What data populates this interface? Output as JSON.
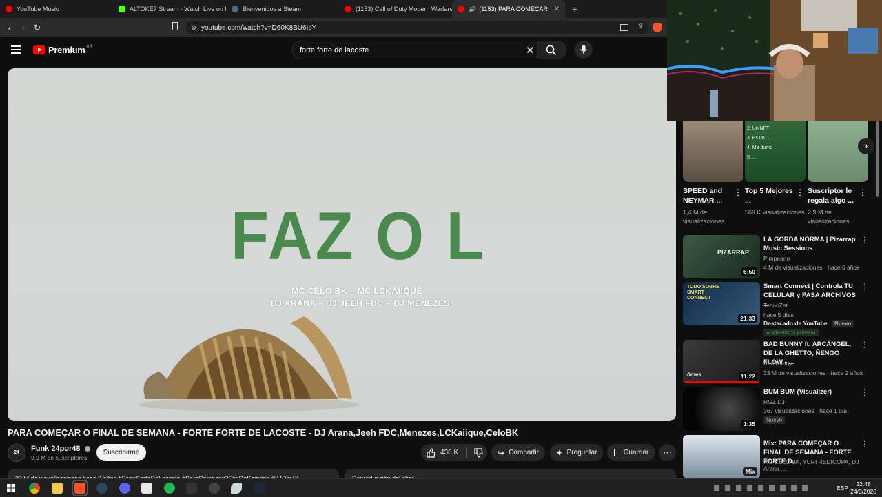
{
  "browser": {
    "tabs": [
      {
        "label": "YouTube Music",
        "color": "#ff0000"
      },
      {
        "label": "ALTOKE7 Stream - Watch Live on Kick",
        "color": "#53fc18"
      },
      {
        "label": "Bienvenidos a Steam",
        "color": "#1b2838"
      },
      {
        "label": "(1153) Call of Duty Modern Warfare",
        "color": "#ff0000"
      },
      {
        "label": "(1153) PARA COMEÇAR O FIN",
        "color": "#ff0000"
      }
    ],
    "new_tab": "+",
    "url": "youtube.com/watch?v=D60K8BU6IsY"
  },
  "masthead": {
    "logo_text": "Premium",
    "country": "AR",
    "search_value": "forte forte de lacoste"
  },
  "video": {
    "overlay_title": "FAZ O L",
    "credit_line1": "MC CELO BK – MC LCKAIIQUE",
    "credit_line2": "DJ ARANA – DJ JEEH FDC – DJ MENEZES",
    "title": "PARA COMEÇAR O FINAL DE SEMANA - FORTE FORTE DE LACOSTE - DJ Arana,Jeeh FDC,Menezes,LCKaiique,CeloBK",
    "channel": "Funk 24por48",
    "avatar": "24",
    "subscribers": "9,9 M de suscriptores",
    "subscribe": "Suscribirme",
    "likes": "438 K",
    "share": "Compartir",
    "ask": "Preguntar",
    "save": "Guardar",
    "description": "33 M de visualizaciones hace 2 años #ForteForteDeLacoste #ParaComeçarOFimDeSemana #24Por48",
    "chat": "Reproducción del chat"
  },
  "shorts": [
    {
      "title": "SPEED and NEYMAR ...",
      "views": "1,4 M de visualizaciones",
      "c1": "#7a6a5a",
      "c2": "#c9b9a4"
    },
    {
      "title": "Top 5 Mejores ...",
      "views": "569 K visualizaciones",
      "c1": "#2f6a3a",
      "c2": "#d8e0d2",
      "list": [
        "2. Un NFT",
        "3. Es un ...",
        "4. Me dumo",
        "5. ..."
      ]
    },
    {
      "title": "Suscriptor le regala algo ...",
      "views": "2,9 M de visualizaciones",
      "c1": "#6b8a6e",
      "c2": "#e6d2c5"
    }
  ],
  "recommended": [
    {
      "title": "LA GORDA NORMA | Pizarrap Music Sessions",
      "channel": "Pimpeano",
      "meta": "4 M de visualizaciones · hace 6 años",
      "duration": "6:50",
      "thumb_text": "PIZARRAP",
      "c1": "#1f3a2a",
      "c2": "#c7c7c7"
    },
    {
      "title": "Smart Connect | Controla TU CELULAR y PASA ARCHIVOS ...",
      "channel": "TecnoZet",
      "meta": "hace 5 días",
      "duration": "21:33",
      "thumb_text": "TODO SOBRE SMART CONNECT",
      "badge1": "Destacado de YouTube",
      "badge2": "Nuevo",
      "members": "Miembros primero",
      "c1": "#0d2a4a",
      "c2": "#e2c19c"
    },
    {
      "title": "BAD BUNNY ft. ARCÁNGEL, DE LA GHETTO, ÑENGO FLOW - ...",
      "channel": "Bad Bunny",
      "meta": "33 M de visualizaciones · hace 2 años",
      "duration": "11:22",
      "thumb_text": "ómes",
      "c1": "#2a2a2a",
      "c2": "#8b7a62"
    },
    {
      "title": "BUM BUM (Visualizer)",
      "channel": "RGZ DJ",
      "meta": "367 visualizaciones · hace 1 día",
      "duration": "1:35",
      "badge2": "Nuevo",
      "c1": "#050505",
      "c2": "#3a3a3a"
    },
    {
      "title": "Mix: PARA COMEÇAR O FINAL DE SEMANA - FORTE FORTE D...",
      "channel": "MC CELO BK, YURI REDICOPA, DJ Arana ...",
      "duration": "Mix",
      "c1": "#c8d4e0",
      "c2": "#3a4a5a"
    }
  ],
  "taskbar": {
    "lang": "ESP",
    "time": "22:48",
    "date": "24/3/2026"
  }
}
